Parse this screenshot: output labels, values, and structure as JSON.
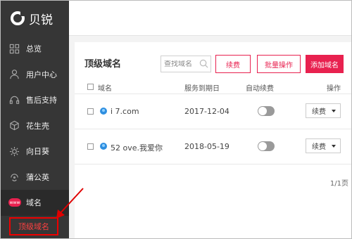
{
  "brand": {
    "logo_text": "贝锐"
  },
  "sidebar": {
    "items": [
      {
        "label": "总览",
        "icon": "grid-icon"
      },
      {
        "label": "用户中心",
        "icon": "user-icon"
      },
      {
        "label": "售后支持",
        "icon": "headset-icon"
      },
      {
        "label": "花生壳",
        "icon": "cube-icon"
      },
      {
        "label": "向日葵",
        "icon": "sunflower-icon"
      },
      {
        "label": "蒲公英",
        "icon": "dandelion-icon"
      },
      {
        "label": "域名",
        "icon": "www-icon",
        "badge": "www",
        "active": true
      }
    ],
    "sub_item": "顶级域名"
  },
  "main": {
    "title": "顶级域名",
    "search_placeholder": "查找域名",
    "buttons": {
      "renew": "续费",
      "batch": "批量操作",
      "add": "添加域名"
    },
    "columns": [
      "域名",
      "服务到期日",
      "自动续费",
      "操作"
    ],
    "rows": [
      {
        "domain": "i 7.com",
        "expiry": "2017-12-04",
        "auto_renew": false,
        "action": "续费"
      },
      {
        "domain": "52 ove.我爱你",
        "expiry": "2018-05-19",
        "auto_renew": false,
        "action": "续费"
      }
    ],
    "pagination": "1/1页"
  },
  "colors": {
    "accent": "#e8214f",
    "sidebar_bg": "#363636",
    "annotation": "#e00000"
  }
}
